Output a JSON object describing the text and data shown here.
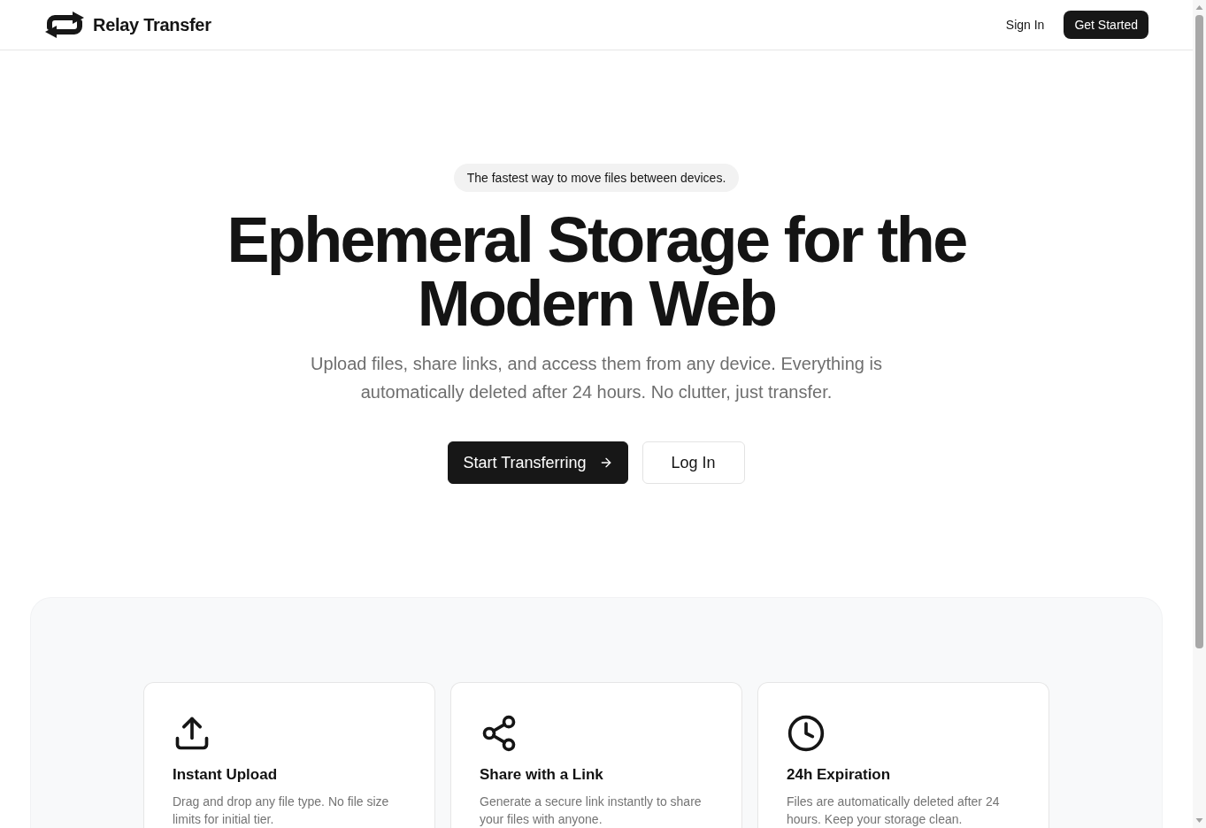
{
  "header": {
    "brand": "Relay Transfer",
    "nav": [
      {
        "label": "Sign In",
        "kind": "link"
      },
      {
        "label": "Get Started",
        "kind": "primary"
      }
    ]
  },
  "hero": {
    "badge": "The fastest way to move files between devices.",
    "title": "Ephemeral Storage for the Modern Web",
    "subtitle": "Upload files, share links, and access them from any device. Everything is automatically deleted after 24 hours. No clutter, just transfer.",
    "actions": [
      {
        "label": "Start Transferring",
        "kind": "primary"
      },
      {
        "label": "Log In",
        "kind": "secondary"
      }
    ]
  },
  "features": [
    {
      "title": "Instant Upload",
      "description": "Drag and drop any file type. No file size limits for initial tier."
    },
    {
      "title": "Share with a Link",
      "description": "Generate a secure link instantly to share your files with anyone."
    },
    {
      "title": "24h Expiration",
      "description": "Files are automatically deleted after 24 hours. Keep your storage clean."
    }
  ]
}
